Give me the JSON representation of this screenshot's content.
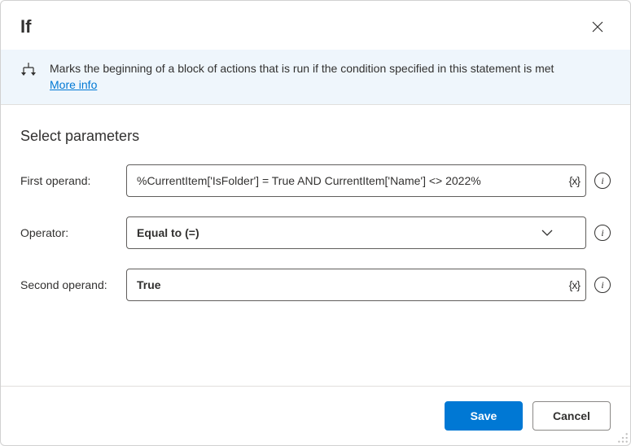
{
  "header": {
    "title": "If"
  },
  "banner": {
    "description": "Marks the beginning of a block of actions that is run if the condition specified in this statement is met",
    "more_info": "More info"
  },
  "section": {
    "title": "Select parameters"
  },
  "params": {
    "first_operand": {
      "label": "First operand:",
      "value": "%CurrentItem['IsFolder'] = True AND CurrentItem['Name'] <> 2022%"
    },
    "operator": {
      "label": "Operator:",
      "value": "Equal to (=)"
    },
    "second_operand": {
      "label": "Second operand:",
      "value": "True"
    }
  },
  "footer": {
    "save": "Save",
    "cancel": "Cancel"
  }
}
